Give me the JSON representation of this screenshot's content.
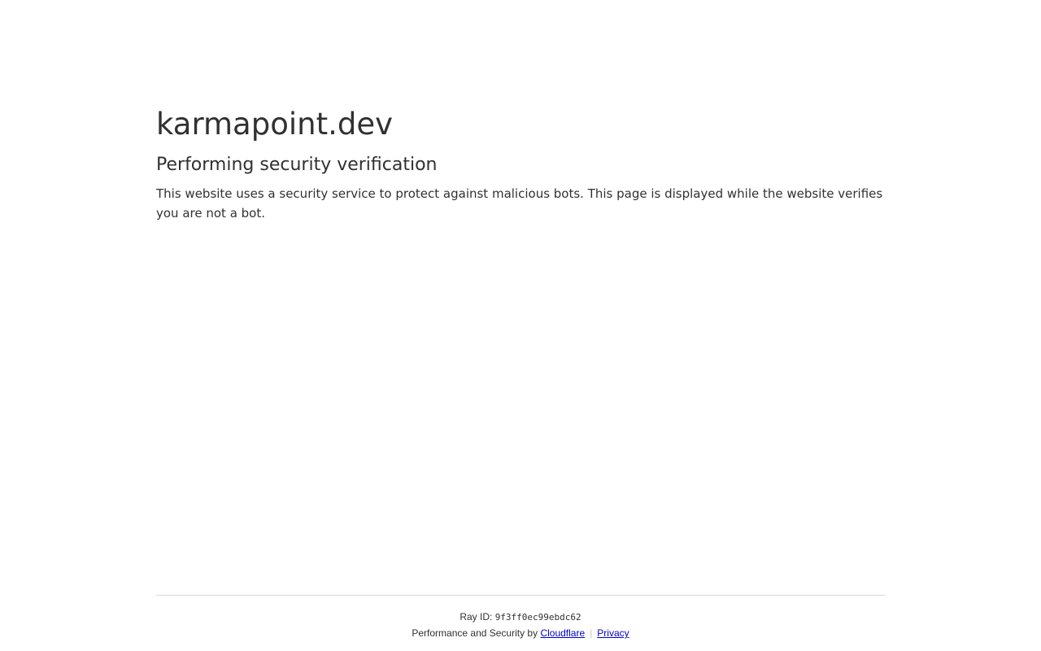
{
  "page": {
    "site_name": "karmapoint.dev",
    "heading": "Performing security verification",
    "description": "This website uses a security service to protect against malicious bots. This page is displayed while the website verifies you are not a bot."
  },
  "footer": {
    "ray_label": "Ray ID:",
    "ray_id": "9f3ff0ec99ebdc62",
    "performance_text": "Performance and Security by",
    "cloudflare_link": "Cloudflare",
    "separator": "|",
    "privacy_link": "Privacy",
    "link_color": "#0000cc"
  }
}
